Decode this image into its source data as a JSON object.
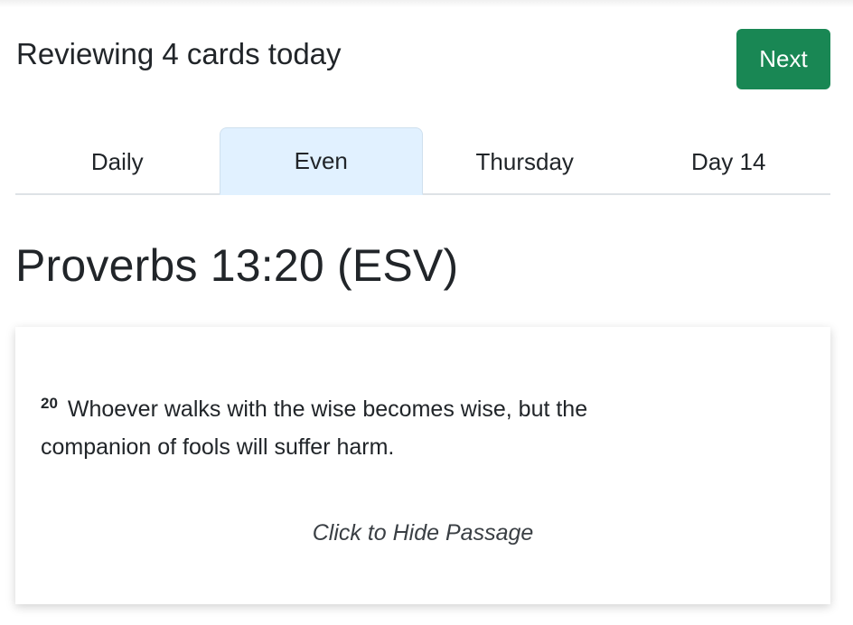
{
  "header": {
    "title": "Reviewing 4 cards today",
    "next_label": "Next"
  },
  "tabs": [
    {
      "label": "Daily",
      "active": false
    },
    {
      "label": "Even",
      "active": true
    },
    {
      "label": "Thursday",
      "active": false
    },
    {
      "label": "Day 14",
      "active": false
    }
  ],
  "passage": {
    "reference": "Proverbs 13:20 (ESV)",
    "verse_number": "20",
    "text": "Whoever walks with the wise becomes wise, but the companion of fools will suffer harm.",
    "toggle_label": "Click to Hide Passage"
  },
  "colors": {
    "accent": "#198754",
    "active_tab_bg": "#e1f1ff",
    "text": "#212529"
  }
}
